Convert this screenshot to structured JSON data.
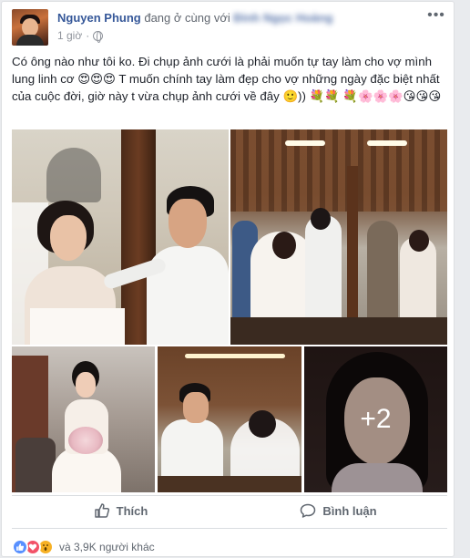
{
  "post": {
    "author": "Nguyen Phung",
    "with_text": "đang ở cùng với",
    "tagged": "Đinh Ngọc Hoàng",
    "time": "1 giờ",
    "text": "Có ông nào như tôi ko. Đi chụp ảnh cưới là phải muốn tự tay làm cho vợ mình lung linh cơ 😍😍😍 T muốn chính tay làm đẹp cho vợ những ngày đặc biệt nhất của cuộc đời, giờ này t vừa chụp ảnh cưới về đây 🙂)) 💐💐 💐🌸🌸🌸😘😘😘"
  },
  "photos": {
    "more_count": "+2"
  },
  "actions": {
    "like_label": "Thích",
    "comment_label": "Bình luận"
  },
  "reactions": {
    "count_text": "và 3,9K người khác"
  },
  "colors": {
    "link": "#365899",
    "meta": "#90949c",
    "action": "#606770",
    "like_blue": "#5890ff",
    "love_red": "#f25268",
    "wow_yellow": "#f7b125"
  },
  "icons": [
    "more-icon",
    "globe-icon",
    "like-icon",
    "comment-icon",
    "like-reaction-icon",
    "love-reaction-icon",
    "wow-reaction-icon"
  ]
}
